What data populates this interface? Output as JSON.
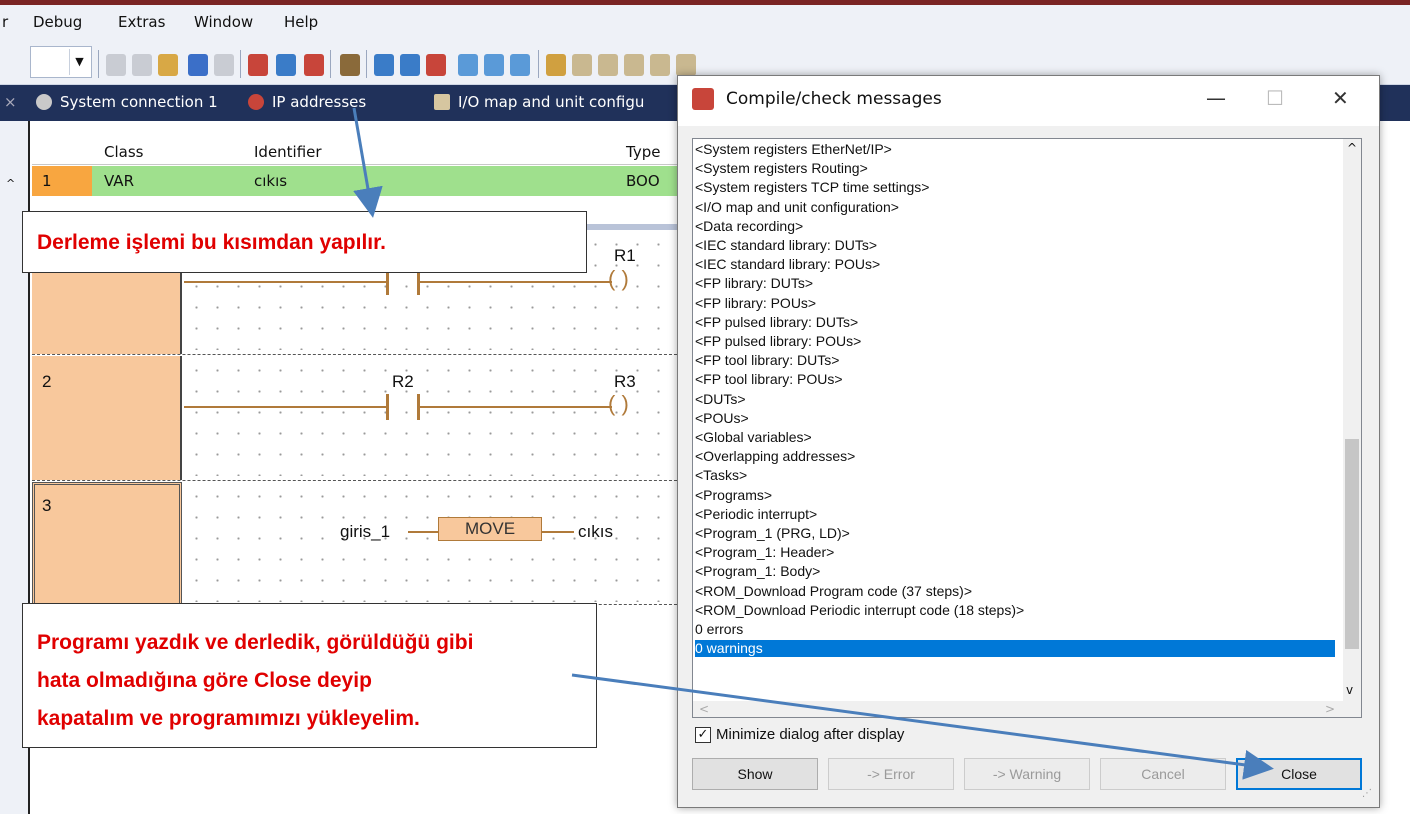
{
  "menu": {
    "partial": "r",
    "items": [
      "Debug",
      "Extras",
      "Window",
      "Help"
    ]
  },
  "tabs": [
    {
      "label": "System connection 1",
      "icon": "connection-icon"
    },
    {
      "label": "IP addresses",
      "icon": "ip-icon"
    },
    {
      "label": "I/O map and unit configu",
      "icon": "io-map-icon"
    }
  ],
  "var_table": {
    "headers": [
      "Class",
      "Identifier",
      "Type"
    ],
    "row": {
      "num": "1",
      "class": "VAR",
      "identifier": "cıkıs",
      "type": "BOO"
    }
  },
  "ladder": {
    "rungs": [
      {
        "num": "",
        "coil": "R1"
      },
      {
        "num": "2",
        "contact": "R2",
        "coil": "R3"
      },
      {
        "num": "3",
        "input": "giris_1",
        "block": "MOVE",
        "output": "cıkıs"
      }
    ]
  },
  "dialog": {
    "title": "Compile/check messages",
    "messages": [
      "<System registers EtherNet/IP>",
      "<System registers Routing>",
      "<System registers TCP time settings>",
      "<I/O map and unit configuration>",
      "<Data recording>",
      "<IEC standard library: DUTs>",
      "<IEC standard library: POUs>",
      "<FP library: DUTs>",
      "<FP library: POUs>",
      "<FP pulsed library: DUTs>",
      "<FP pulsed library: POUs>",
      "<FP tool library: DUTs>",
      "<FP tool library: POUs>",
      "<DUTs>",
      "<POUs>",
      "<Global variables>",
      "<Overlapping addresses>",
      "<Tasks>",
      "<Programs>",
      "<Periodic interrupt>",
      "<Program_1 (PRG, LD)>",
      "<Program_1: Header>",
      "<Program_1: Body>",
      "<ROM_Download Program code (37 steps)>",
      "<ROM_Download Periodic interrupt code (18 steps)>",
      "0 errors",
      "0 warnings"
    ],
    "selected_index": 26,
    "checkbox_label": "Minimize dialog after display",
    "checkbox_checked": true,
    "buttons": [
      {
        "label": "Show",
        "enabled": true
      },
      {
        "label": "-> Error",
        "enabled": false
      },
      {
        "label": "-> Warning",
        "enabled": false
      },
      {
        "label": "Cancel",
        "enabled": false
      },
      {
        "label": "Close",
        "enabled": true
      }
    ]
  },
  "annotations": {
    "top": "Derleme işlemi bu kısımdan yapılır.",
    "bottom": [
      "Programı yazdık ve derledik, görüldüğü gibi",
      "hata olmadığına göre Close deyip",
      "kapatalım ve programımızı yükleyelim."
    ]
  },
  "colors": {
    "accent": "#0078d7",
    "annotation_text": "#e00000",
    "arrow": "#4a7ebb",
    "rung_fill": "#f8c89c",
    "var_row": "#9fe08d",
    "tabbar": "#20315a"
  }
}
